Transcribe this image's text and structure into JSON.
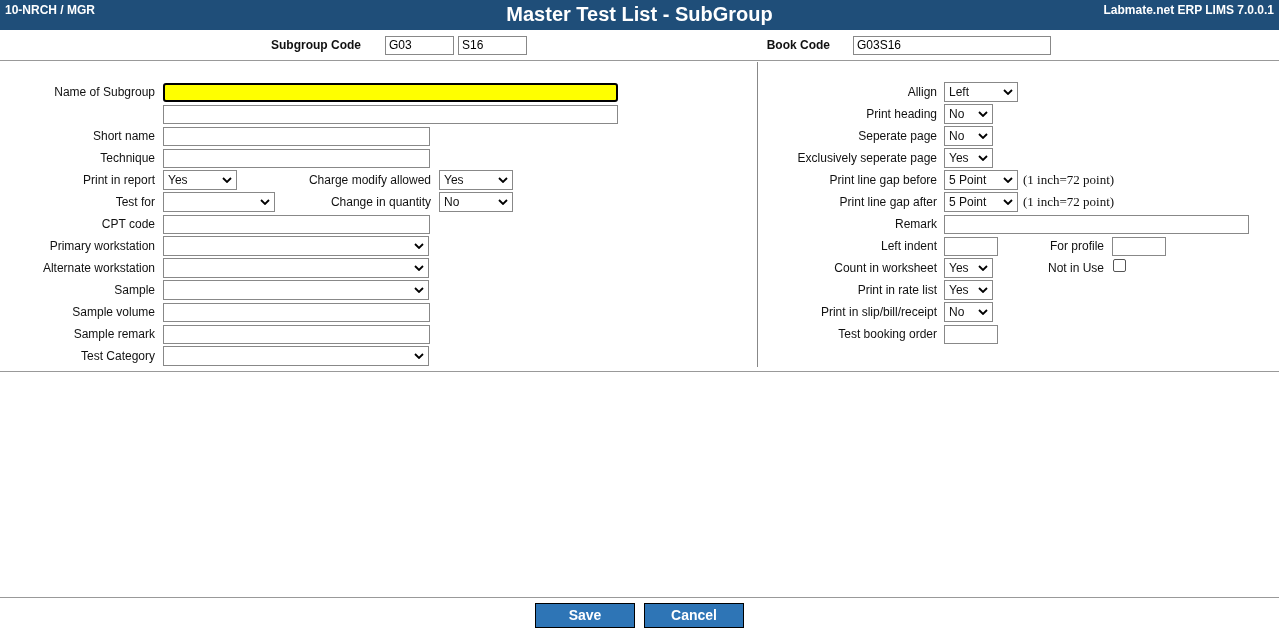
{
  "header": {
    "user": "10-NRCH / MGR",
    "title": "Master Test List - SubGroup",
    "product": "Labmate.net ERP LIMS 7.0.0.1"
  },
  "codes": {
    "subgroup_label": "Subgroup Code",
    "subgroup_values": [
      "G03",
      "S16"
    ],
    "book_label": "Book Code",
    "book_value": "G03S16"
  },
  "left_fields": [
    {
      "label": "Name of Subgroup",
      "kind": "text",
      "focused": true
    },
    {
      "kind": "text",
      "focused": false
    },
    {
      "label": "Short name",
      "kind": "text",
      "focused": false
    },
    {
      "label": "Technique",
      "kind": "text",
      "focused": false
    },
    {
      "label": "Print in report",
      "kind": "select",
      "value": "Yes",
      "focused": false,
      "extra": {
        "label": "Charge modify allowed",
        "kind": "select",
        "value": "Yes"
      }
    },
    {
      "label": "Test for",
      "kind": "select",
      "focused": false,
      "extra": {
        "label": "Change in quantity",
        "kind": "select",
        "value": "No"
      }
    },
    {
      "label": "CPT code",
      "kind": "text",
      "focused": false
    },
    {
      "label": "Primary workstation",
      "kind": "select",
      "focused": false
    },
    {
      "label": "Alternate workstation",
      "kind": "select",
      "focused": false
    },
    {
      "label": "Sample",
      "kind": "select",
      "focused": false
    },
    {
      "label": "Sample volume",
      "kind": "text",
      "focused": false
    },
    {
      "label": "Sample remark",
      "kind": "text",
      "focused": false
    },
    {
      "label": "Test Category",
      "kind": "select",
      "focused": false
    }
  ],
  "right_fields": [
    {
      "label": "Allign",
      "kind": "select",
      "value": "Left"
    },
    {
      "label": "Print heading",
      "kind": "select",
      "value": "No"
    },
    {
      "label": "Seperate page",
      "kind": "select",
      "value": "No"
    },
    {
      "label": "Exclusively seperate page",
      "kind": "select",
      "value": "Yes"
    },
    {
      "label": "Print line gap before",
      "kind": "select",
      "value": "5 Point",
      "note": "(1 inch=72 point)"
    },
    {
      "label": "Print line gap after",
      "kind": "select",
      "value": "5 Point",
      "note": "(1 inch=72 point)"
    },
    {
      "label": "Remark",
      "kind": "text"
    },
    {
      "label": "Left indent",
      "kind": "text",
      "extra": {
        "label": "For profile",
        "kind": "text"
      }
    },
    {
      "label": "Count in worksheet",
      "kind": "select",
      "value": "Yes",
      "extra": {
        "label": "Not in Use",
        "kind": "checkbox",
        "checked": false
      }
    },
    {
      "label": "Print in rate list",
      "kind": "select",
      "value": "Yes"
    },
    {
      "label": "Print in slip/bill/receipt",
      "kind": "select",
      "value": "No"
    },
    {
      "label": "Test booking order",
      "kind": "text"
    }
  ],
  "buttons": [
    {
      "label": "Save"
    },
    {
      "label": "Cancel"
    }
  ]
}
